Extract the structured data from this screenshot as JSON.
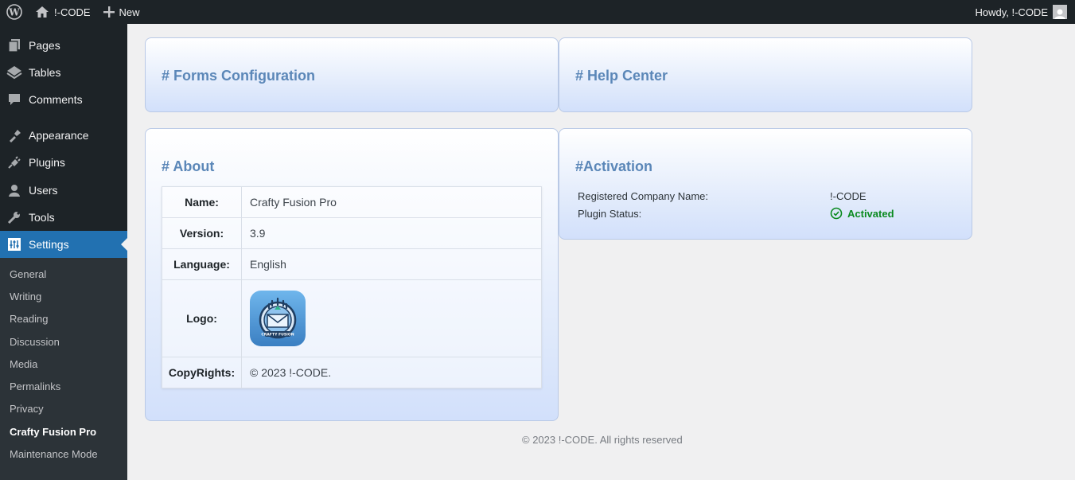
{
  "adminbar": {
    "site_name": "!-CODE",
    "new_label": "New",
    "howdy": "Howdy, !-CODE"
  },
  "sidebar": {
    "items": [
      {
        "label": "Pages",
        "icon": "pages-icon"
      },
      {
        "label": "Tables",
        "icon": "tables-icon"
      },
      {
        "label": "Comments",
        "icon": "comments-icon"
      },
      {
        "label": "Appearance",
        "icon": "appearance-icon"
      },
      {
        "label": "Plugins",
        "icon": "plugins-icon"
      },
      {
        "label": "Users",
        "icon": "users-icon"
      },
      {
        "label": "Tools",
        "icon": "tools-icon"
      },
      {
        "label": "Settings",
        "icon": "settings-icon"
      }
    ],
    "submenu": [
      "General",
      "Writing",
      "Reading",
      "Discussion",
      "Media",
      "Permalinks",
      "Privacy",
      "Crafty Fusion Pro",
      "Maintenance Mode"
    ]
  },
  "panels": {
    "forms_title": "# Forms Configuration",
    "help_title": "# Help Center",
    "about_title": "# About",
    "activation_title": "#Activation"
  },
  "about": {
    "name_label": "Name:",
    "name_value": "Crafty Fusion Pro",
    "version_label": "Version:",
    "version_value": "3.9",
    "language_label": "Language:",
    "language_value": "English",
    "logo_label": "Logo:",
    "logo_text": "CRAFTY FUSION",
    "copyrights_label": "CopyRights:",
    "copyrights_value": "© 2023 !-CODE."
  },
  "activation": {
    "company_label": "Registered Company Name:",
    "company_value": "!-CODE",
    "status_label": "Plugin Status:",
    "status_value": "Activated",
    "status_color": "#0a8a1f"
  },
  "footer": {
    "text": "© 2023 !-CODE. All rights reserved"
  },
  "colors": {
    "accent": "#2271b1",
    "heading": "#5b87b8"
  }
}
